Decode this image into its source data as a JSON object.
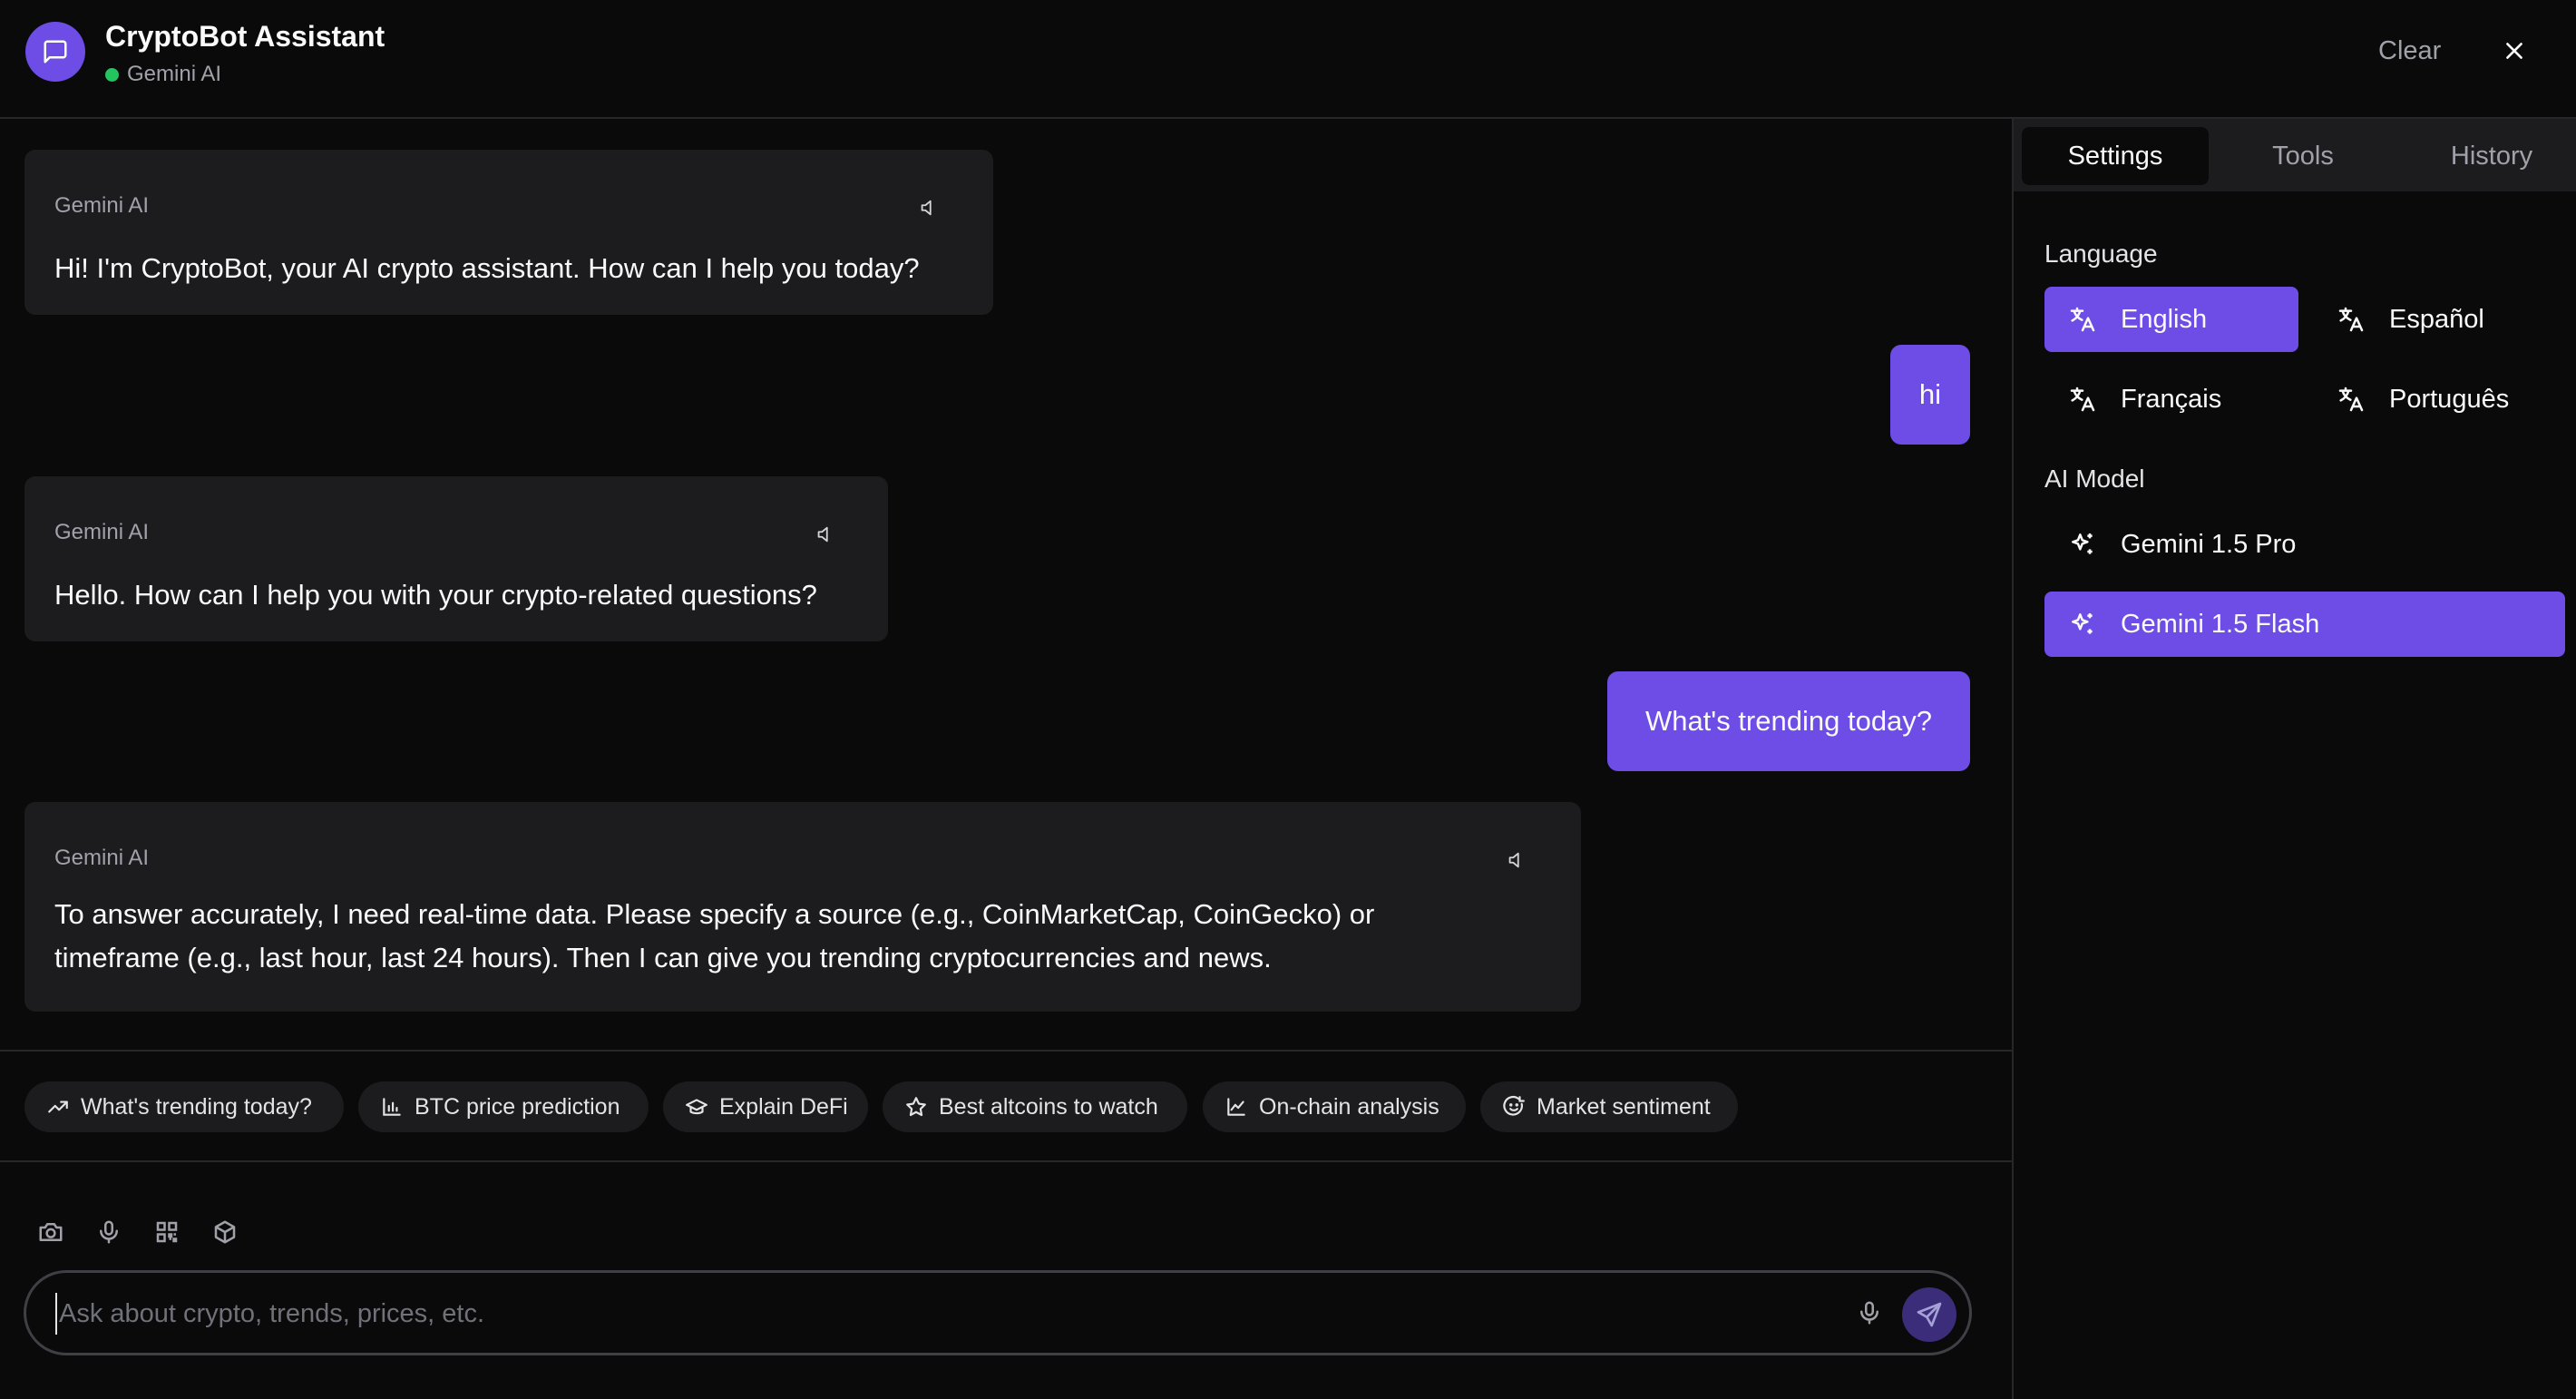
{
  "header": {
    "title": "CryptoBot Assistant",
    "status_label": "Gemini AI",
    "clear_label": "Clear"
  },
  "messages": [
    {
      "role": "bot",
      "sender": "Gemini AI",
      "text": "Hi! I'm CryptoBot, your AI crypto assistant. How can I help you today?"
    },
    {
      "role": "user",
      "text": "hi"
    },
    {
      "role": "bot",
      "sender": "Gemini AI",
      "text": "Hello. How can I help you with your crypto-related questions?"
    },
    {
      "role": "user",
      "text": "What's trending today?"
    },
    {
      "role": "bot",
      "sender": "Gemini AI",
      "text_lines": [
        "To answer accurately, I need real-time data. Please specify a source (e.g., CoinMarketCap, CoinGecko) or",
        "timeframe (e.g., last hour, last 24 hours). Then I can give you trending cryptocurrencies and news."
      ]
    }
  ],
  "suggestions": [
    {
      "label": "What's trending today?",
      "icon": "trending-up-icon"
    },
    {
      "label": "BTC price prediction",
      "icon": "bar-chart-icon"
    },
    {
      "label": "Explain DeFi",
      "icon": "graduation-cap-icon"
    },
    {
      "label": "Best altcoins to watch",
      "icon": "star-icon"
    },
    {
      "label": "On-chain analysis",
      "icon": "line-chart-icon"
    },
    {
      "label": "Market sentiment",
      "icon": "smile-icon"
    }
  ],
  "toolbar_icons": [
    "camera-icon",
    "microphone-icon",
    "qr-code-icon",
    "cube-icon"
  ],
  "input": {
    "placeholder": "Ask about crypto, trends, prices, etc.",
    "value": ""
  },
  "side_panel": {
    "tabs": [
      {
        "label": "Settings",
        "active": true
      },
      {
        "label": "Tools",
        "active": false
      },
      {
        "label": "History",
        "active": false
      }
    ],
    "language_label": "Language",
    "languages": [
      {
        "label": "English",
        "selected": true
      },
      {
        "label": "Español",
        "selected": false
      },
      {
        "label": "Français",
        "selected": false
      },
      {
        "label": "Português",
        "selected": false
      }
    ],
    "model_label": "AI Model",
    "models": [
      {
        "label": "Gemini 1.5 Pro",
        "selected": false
      },
      {
        "label": "Gemini 1.5 Flash",
        "selected": true
      }
    ]
  },
  "colors": {
    "background": "#0a0a0b",
    "accent": "#6d4de6",
    "bubble": "#1c1c1f",
    "status_online": "#22c55e"
  }
}
